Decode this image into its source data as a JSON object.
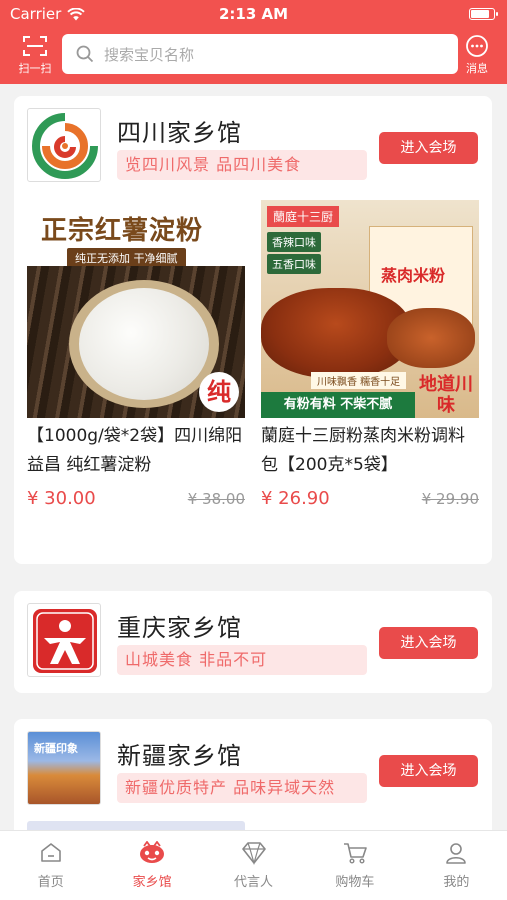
{
  "status": {
    "carrier": "Carrier",
    "time": "2:13 AM",
    "battery_level": 0.9
  },
  "header": {
    "scan_label": "扫一扫",
    "search_placeholder": "搜索宝贝名称",
    "message_label": "消息"
  },
  "halls": [
    {
      "name": "四川家乡馆",
      "slogan": "览四川风景   品四川美食",
      "enter_label": "进入会场",
      "products": [
        {
          "name": "【1000g/袋*2袋】四川绵阳 益昌 纯红薯淀粉",
          "price": "¥ 30.00",
          "old_price": "¥ 38.00",
          "img_title": "正宗红薯淀粉",
          "img_sub": "纯正无添加 干净细腻",
          "img_badge": "纯"
        },
        {
          "name": "蘭庭十三厨粉蒸肉米粉调料包【200克*5袋】",
          "price": "¥ 26.90",
          "old_price": "¥ 29.90",
          "img_brand": "蘭庭十三厨",
          "img_tag1": "香辣口味",
          "img_tag2": "五香口味",
          "img_pack": "蒸肉米粉",
          "img_strip": "川味飘香   糯香十足",
          "img_bottom": "有粉有料 不柴不腻",
          "img_badge": "地道川味"
        }
      ]
    },
    {
      "name": "重庆家乡馆",
      "slogan": "山城美食   非品不可",
      "enter_label": "进入会场"
    },
    {
      "name": "新疆家乡馆",
      "slogan": "新疆优质特产   品味异域天然",
      "enter_label": "进入会场",
      "logo_text": "新疆印象"
    }
  ],
  "tabs": [
    {
      "label": "首页",
      "icon": "home-icon",
      "active": false
    },
    {
      "label": "家乡馆",
      "icon": "hometown-icon",
      "active": true
    },
    {
      "label": "代言人",
      "icon": "diamond-icon",
      "active": false
    },
    {
      "label": "购物车",
      "icon": "cart-icon",
      "active": false
    },
    {
      "label": "我的",
      "icon": "user-icon",
      "active": false
    }
  ],
  "colors": {
    "brand": "#f2524f",
    "accent": "#e94b4b",
    "slogan_bg": "#fde6e6",
    "page_bg": "#f2f2f2"
  }
}
